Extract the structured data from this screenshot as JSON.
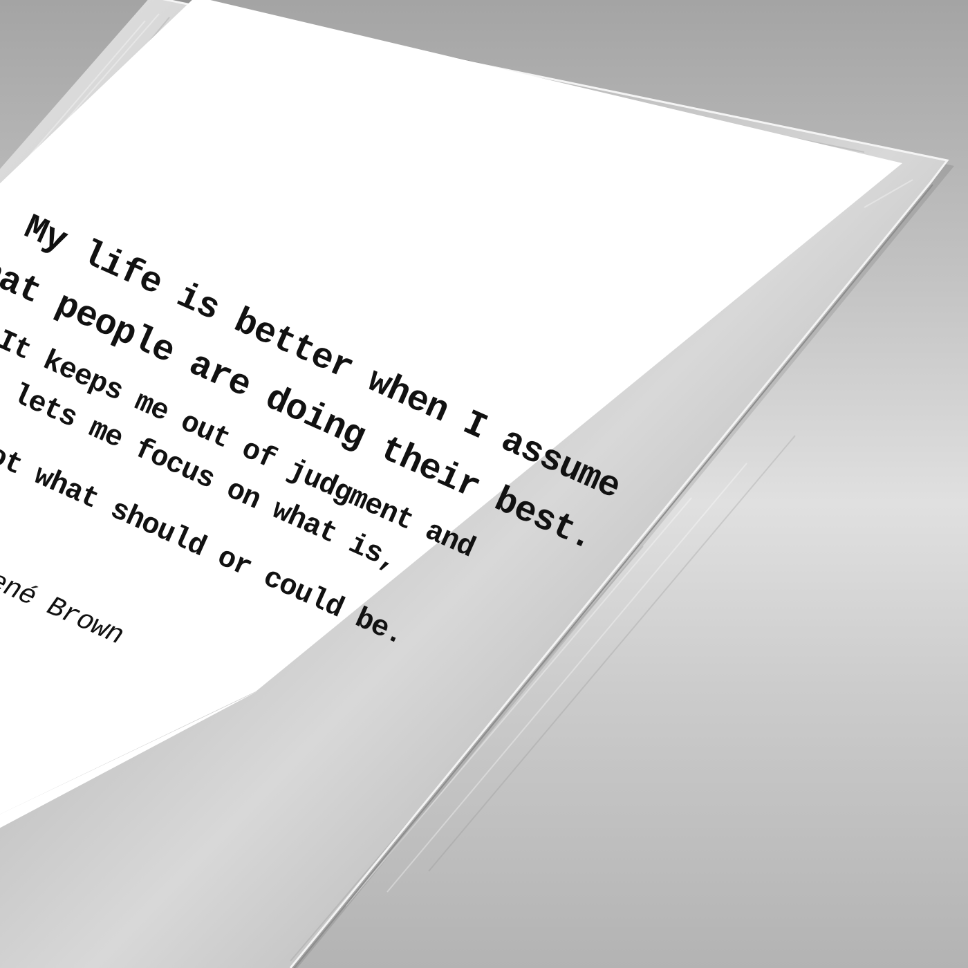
{
  "quote": {
    "lines": [
      "My life is better when I assume",
      "hat people are doing their best.",
      "It keeps me out of judgment and",
      "lets me focus on what is,",
      "ot what should or could be."
    ],
    "attribution": "ené Brown"
  },
  "colors": {
    "background_top": "#a4a4a4",
    "background_mid": "#e0e0e0",
    "frame": "#c8c8c8",
    "paper": "#ffffff",
    "text": "#111111"
  }
}
